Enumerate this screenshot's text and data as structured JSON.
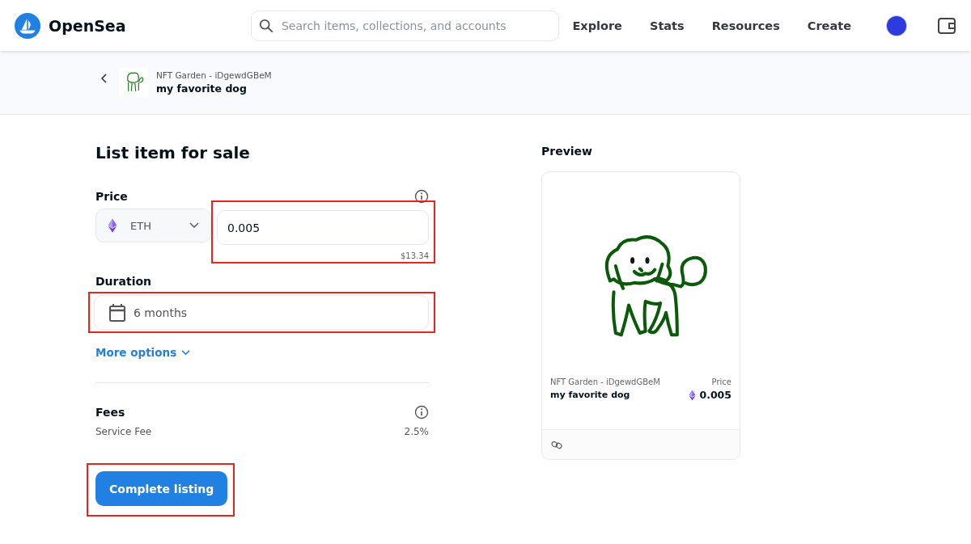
{
  "header": {
    "brand": "OpenSea",
    "search": {
      "placeholder": "Search items, collections, and accounts"
    },
    "nav": [
      "Explore",
      "Stats",
      "Resources",
      "Create"
    ]
  },
  "item_bar": {
    "collection": "NFT Garden - iDgewdGBeM",
    "name": "my favorite dog"
  },
  "form": {
    "title": "List item for sale",
    "price": {
      "label": "Price",
      "currency": "ETH",
      "value": "0.005",
      "usd": "$13.34",
      "highlighted": true
    },
    "duration": {
      "label": "Duration",
      "value": "6 months",
      "highlighted": true
    },
    "more_options": "More options",
    "fees": {
      "label": "Fees",
      "rows": [
        {
          "name": "Service Fee",
          "value": "2.5%"
        }
      ]
    },
    "submit": {
      "label": "Complete listing",
      "highlighted": true
    }
  },
  "preview": {
    "title": "Preview",
    "collection": "NFT Garden - iDgewdGBeM",
    "name": "my favorite dog",
    "price_label": "Price",
    "price": "0.005"
  }
}
